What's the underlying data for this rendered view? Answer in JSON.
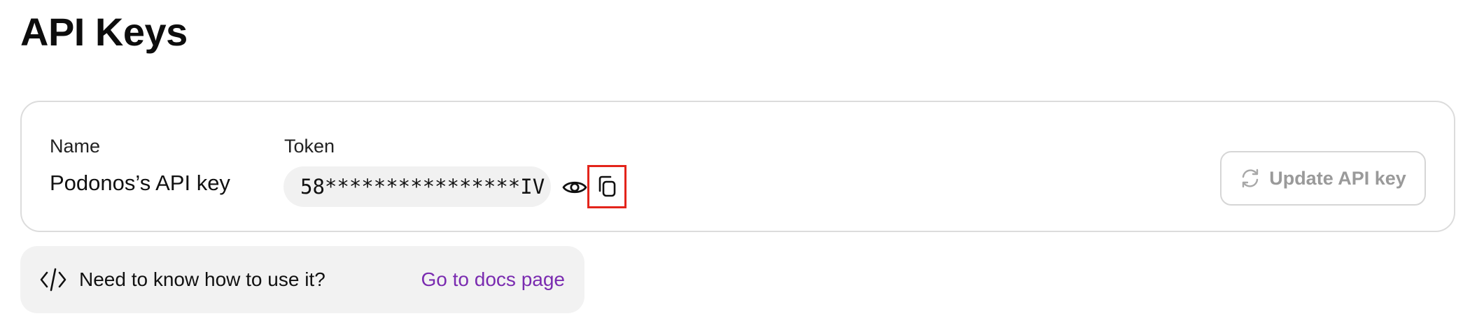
{
  "page": {
    "title": "API Keys"
  },
  "api_key": {
    "name_label": "Name",
    "token_label": "Token",
    "name": "Podonos’s API key",
    "token_masked": "58****************IV",
    "reveal_icon": "eye-icon",
    "copy_icon": "copy-icon",
    "update_label": "Update API key",
    "update_icon": "refresh-icon"
  },
  "docs": {
    "icon": "code-icon",
    "question": "Need to know how to use it?",
    "link_label": "Go to docs page"
  },
  "colors": {
    "link": "#7a2bb0",
    "highlight_box": "#e3241b",
    "disabled_text": "#9a9a9a",
    "pill_background": "#f1f1f1",
    "banner_background": "#f2f2f2"
  }
}
